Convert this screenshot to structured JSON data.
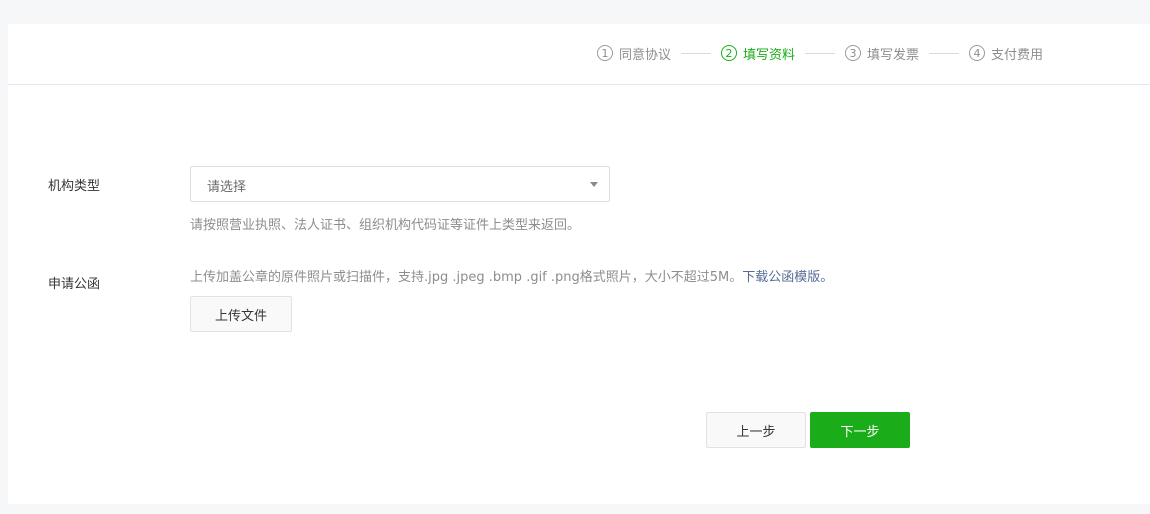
{
  "steps": [
    {
      "num": "1",
      "label": "同意协议",
      "active": false
    },
    {
      "num": "2",
      "label": "填写资料",
      "active": true
    },
    {
      "num": "3",
      "label": "填写发票",
      "active": false
    },
    {
      "num": "4",
      "label": "支付费用",
      "active": false
    }
  ],
  "form": {
    "org_type": {
      "label": "机构类型",
      "placeholder": "请选择",
      "hint": "请按照营业执照、法人证书、组织机构代码证等证件上类型来返回。"
    },
    "letter": {
      "label": "申请公函",
      "hint": "上传加盖公章的原件照片或扫描件，支持.jpg .jpeg .bmp .gif .png格式照片，大小不超过5M。",
      "download_link": "下载公函模版。",
      "upload_button": "上传文件"
    }
  },
  "actions": {
    "prev": "上一步",
    "next": "下一步"
  },
  "colors": {
    "accent": "#1aad19",
    "link": "#576b95"
  }
}
